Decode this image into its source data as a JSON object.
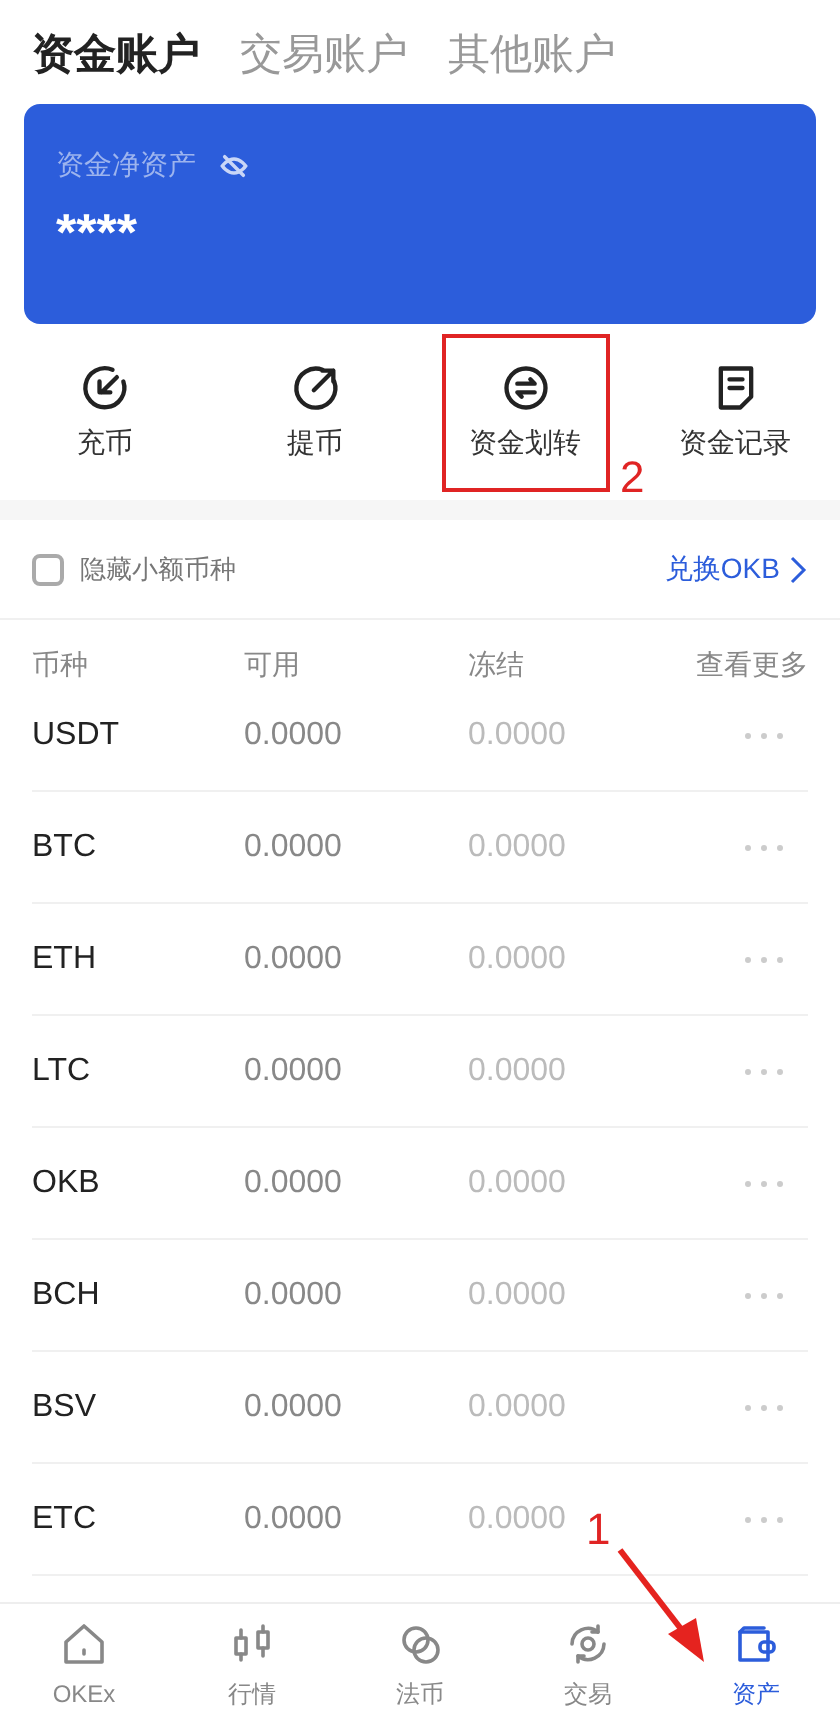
{
  "tabs": [
    {
      "label": "资金账户",
      "selected": true
    },
    {
      "label": "交易账户",
      "selected": false
    },
    {
      "label": "其他账户",
      "selected": false
    }
  ],
  "balance_card": {
    "label": "资金净资产",
    "value": "****"
  },
  "actions": [
    {
      "label": "充币",
      "kind": "deposit",
      "highlighted": false
    },
    {
      "label": "提币",
      "kind": "withdraw",
      "highlighted": false
    },
    {
      "label": "资金划转",
      "kind": "transfer",
      "highlighted": true
    },
    {
      "label": "资金记录",
      "kind": "record",
      "highlighted": false
    }
  ],
  "hide_small": {
    "label": "隐藏小额币种",
    "checked": false
  },
  "convert_link": "兑换OKB",
  "table": {
    "columns": [
      "币种",
      "可用",
      "冻结",
      "查看更多"
    ],
    "rows": [
      {
        "coin": "USDT",
        "available": "0.0000",
        "frozen": "0.0000"
      },
      {
        "coin": "BTC",
        "available": "0.0000",
        "frozen": "0.0000"
      },
      {
        "coin": "ETH",
        "available": "0.0000",
        "frozen": "0.0000"
      },
      {
        "coin": "LTC",
        "available": "0.0000",
        "frozen": "0.0000"
      },
      {
        "coin": "OKB",
        "available": "0.0000",
        "frozen": "0.0000"
      },
      {
        "coin": "BCH",
        "available": "0.0000",
        "frozen": "0.0000"
      },
      {
        "coin": "BSV",
        "available": "0.0000",
        "frozen": "0.0000"
      },
      {
        "coin": "ETC",
        "available": "0.0000",
        "frozen": "0.0000"
      }
    ]
  },
  "bottom_nav": [
    {
      "label": "OKEx",
      "kind": "home",
      "selected": false
    },
    {
      "label": "行情",
      "kind": "market",
      "selected": false
    },
    {
      "label": "法币",
      "kind": "fiat",
      "selected": false
    },
    {
      "label": "交易",
      "kind": "trade",
      "selected": false
    },
    {
      "label": "资产",
      "kind": "assets",
      "selected": true
    }
  ],
  "annotations": [
    {
      "text": "2"
    },
    {
      "text": "1"
    }
  ]
}
